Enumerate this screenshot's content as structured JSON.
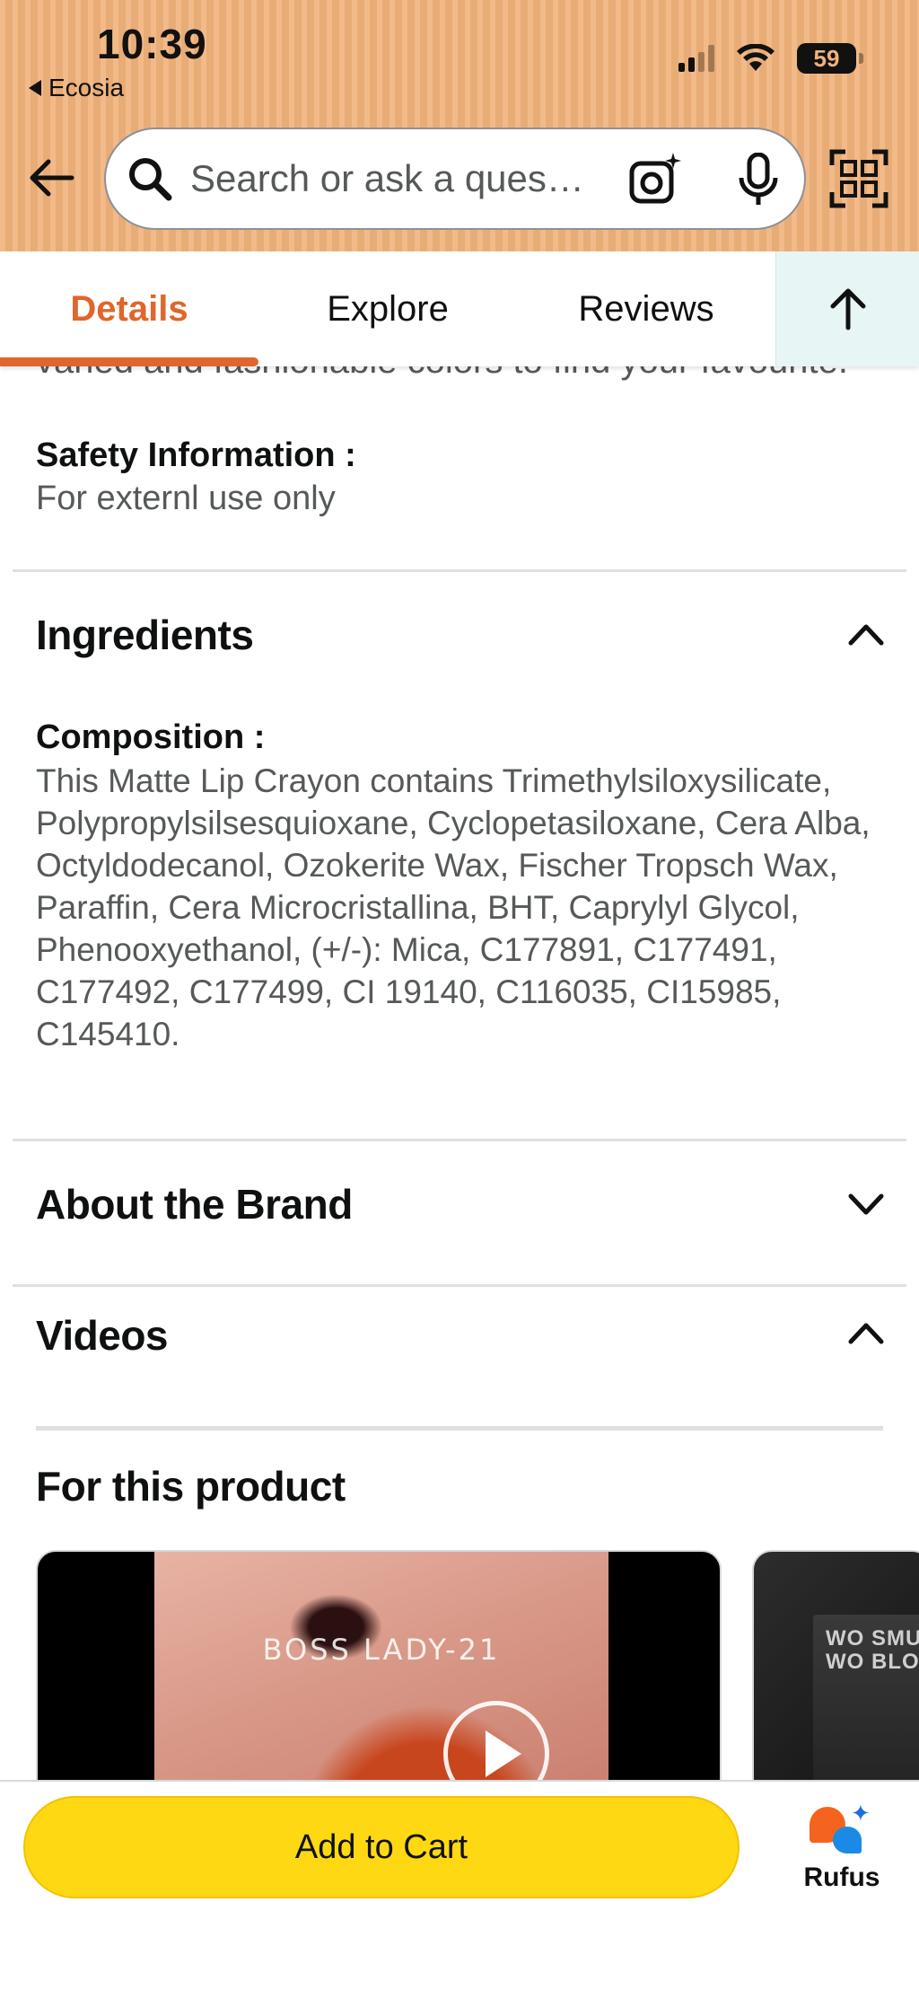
{
  "status_bar": {
    "time": "10:39",
    "back_app": "Ecosia",
    "battery": "59"
  },
  "search": {
    "placeholder": "Search or ask a question"
  },
  "tabs": [
    {
      "label": "Details",
      "active": true
    },
    {
      "label": "Explore",
      "active": false
    },
    {
      "label": "Reviews",
      "active": false
    }
  ],
  "details": {
    "cut_text": "varied and fashionable colors to find your favourite.",
    "safety_title": "Safety Information :",
    "safety_text": "For externl use only"
  },
  "sections": {
    "ingredients": {
      "title": "Ingredients",
      "expanded": true,
      "composition_title": "Composition :",
      "composition_text": "This Matte Lip Crayon contains Trimethylsiloxysilicate, Polypropylsilsesquioxane, Cyclopetasiloxane, Cera Alba, Octyldodecanol, Ozokerite Wax, Fischer Tropsch Wax, Paraffin, Cera Microcristallina, BHT, Caprylyl Glycol, Phenooxyethanol, (+/-): Mica, C177891, C177491, C177492, C177499, CI 19140, C116035, CI15985, C145410."
    },
    "about_brand": {
      "title": "About the Brand",
      "expanded": false
    },
    "videos": {
      "title": "Videos",
      "expanded": true,
      "subheading": "For this product",
      "video_caption": "BOSS LADY-21",
      "second_video_text": "WO SMU WO BLO"
    }
  },
  "bottom_bar": {
    "add_to_cart": "Add to Cart",
    "rufus": "Rufus"
  },
  "colors": {
    "header_bg": "#f0b27a",
    "accent": "#e0662b",
    "cart_button": "#ffd814",
    "scroll_top_bg": "#e7f6f4"
  }
}
